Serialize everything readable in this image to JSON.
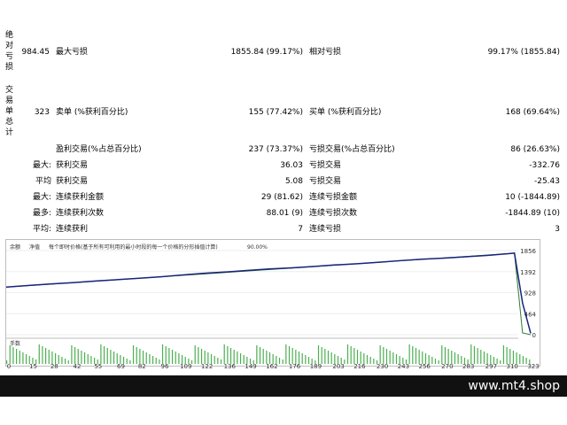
{
  "vertical_labels": {
    "absolute_loss": "绝对亏损",
    "total_trades": "交易单总计"
  },
  "rows": {
    "r1": {
      "left_value": "984.45",
      "left_label": "最大亏损",
      "mid_value": "1855.84 (99.17%)",
      "mid_label": "相对亏损",
      "right_value": "99.17% (1855.84)"
    },
    "r2": {
      "left_value": "323",
      "left_label": "卖单 (%获利百分比)",
      "mid_value": "155 (77.42%)",
      "mid_label": "买单 (%获利百分比)",
      "right_value": "168 (69.64%)"
    },
    "r3": {
      "left_label": "盈利交易(%占总百分比)",
      "mid_value": "237 (73.37%)",
      "mid_label": "亏损交易(%占总百分比)",
      "right_value": "86 (26.63%)"
    },
    "r4": {
      "prefix": "最大:",
      "left_label": "获利交易",
      "mid_value": "36.03",
      "mid_label": "亏损交易",
      "right_value": "-332.76"
    },
    "r5": {
      "prefix": "平均",
      "left_label": "获利交易",
      "mid_value": "5.08",
      "mid_label": "亏损交易",
      "right_value": "-25.43"
    },
    "r6": {
      "prefix": "最大:",
      "left_label": "连续获利金额",
      "mid_value": "29 (81.62)",
      "mid_label": "连续亏损金额",
      "right_value": "10 (-1844.89)"
    },
    "r7": {
      "prefix": "最多:",
      "left_label": "连续获利次数",
      "mid_value": "88.01 (9)",
      "mid_label": "连续亏损次数",
      "right_value": "-1844.89 (10)"
    },
    "r8": {
      "prefix": "平均:",
      "left_label": "连续获利",
      "mid_value": "7",
      "mid_label": "连续亏损",
      "right_value": "3"
    }
  },
  "chart": {
    "legend_balance": "余额",
    "legend_equity": "净值",
    "legend_desc": "每个即时价格(基于所有可利用的最小时段的每一个价格的分形插值计算)",
    "legend_quality": "90.00%",
    "y_ticks": [
      "1856",
      "1392",
      "928",
      "464",
      "0"
    ],
    "volume_label": "手数",
    "x_ticks": [
      "0",
      "15",
      "28",
      "42",
      "55",
      "69",
      "82",
      "96",
      "109",
      "122",
      "136",
      "149",
      "162",
      "176",
      "189",
      "203",
      "216",
      "230",
      "243",
      "256",
      "270",
      "283",
      "297",
      "310",
      "323"
    ],
    "colors": {
      "balance": "#1a237e",
      "equity": "#2e7d32",
      "volume": "#4caf50"
    }
  },
  "chart_data": {
    "type": "line",
    "ylim": [
      0,
      1856
    ],
    "xlim": [
      0,
      323
    ],
    "series": [
      {
        "name": "余额",
        "x": [
          0,
          15,
          28,
          42,
          55,
          69,
          82,
          96,
          109,
          122,
          136,
          149,
          162,
          176,
          189,
          203,
          216,
          230,
          243,
          256,
          270,
          283,
          297,
          310,
          313,
          318,
          323
        ],
        "values": [
          1050,
          1090,
          1120,
          1150,
          1185,
          1215,
          1245,
          1280,
          1320,
          1355,
          1385,
          1420,
          1450,
          1475,
          1505,
          1540,
          1565,
          1600,
          1635,
          1665,
          1690,
          1720,
          1750,
          1790,
          1800,
          700,
          30
        ]
      },
      {
        "name": "净值",
        "x": [
          0,
          310,
          313,
          318,
          323
        ],
        "values": [
          1050,
          1790,
          1800,
          40,
          0
        ]
      }
    ]
  },
  "footer": {
    "site": "www.mt4.shop"
  }
}
